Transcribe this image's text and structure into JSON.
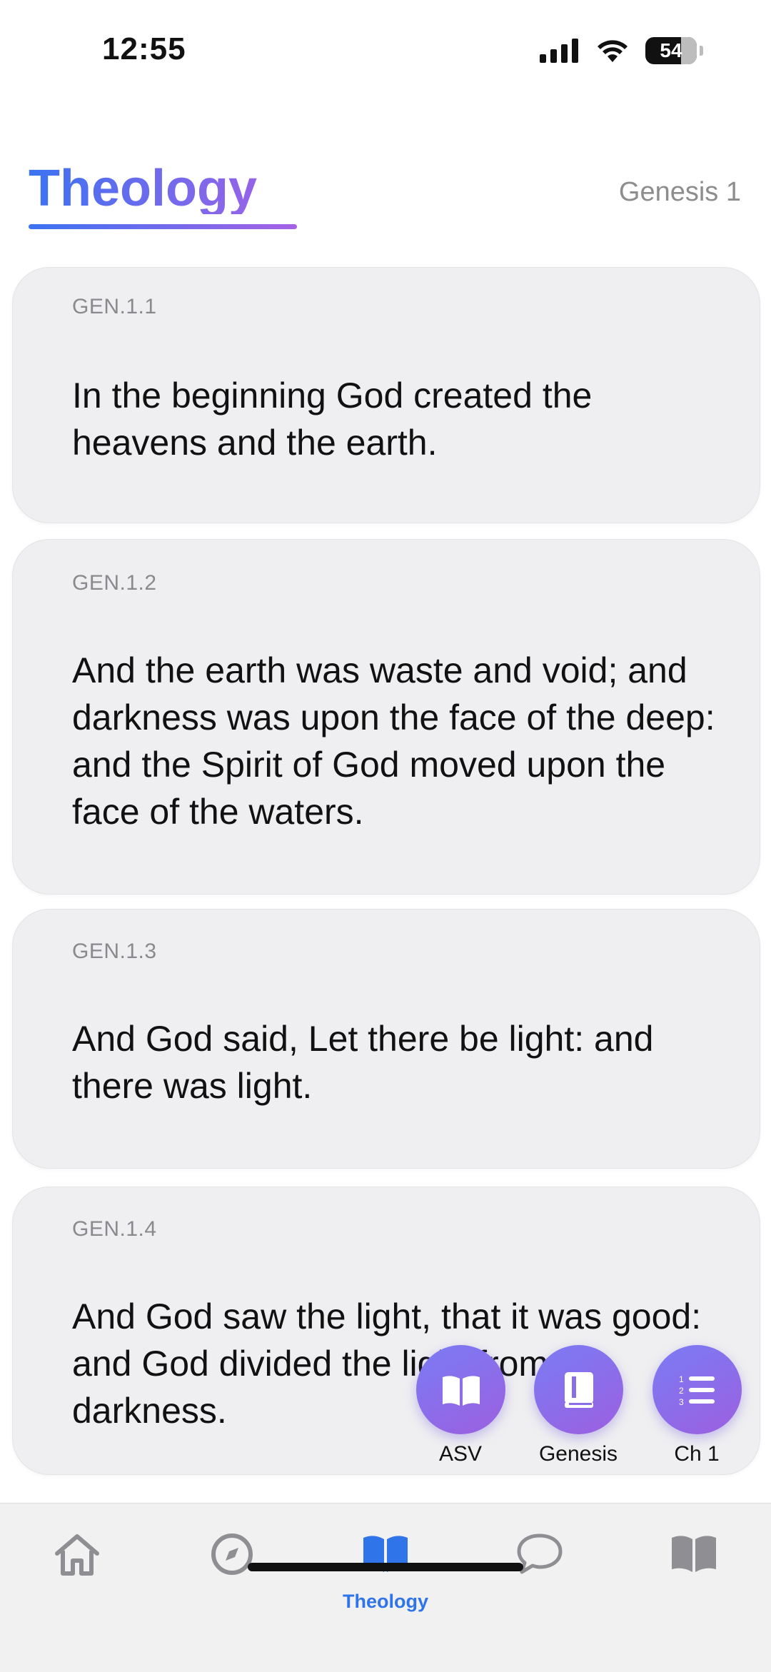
{
  "status_bar": {
    "time": "12:55",
    "battery": "54"
  },
  "header": {
    "app_title": "Theology",
    "book_chapter": "Genesis 1"
  },
  "verses": [
    {
      "ref": "GEN.1.1",
      "text": "In the beginning God created the heavens and the earth."
    },
    {
      "ref": "GEN.1.2",
      "text": "And the earth was waste and void; and darkness was upon the face of the deep: and the Spirit of God moved upon the face of the waters."
    },
    {
      "ref": "GEN.1.3",
      "text": "And God said, Let there be light: and there was light."
    },
    {
      "ref": "GEN.1.4",
      "text": "And God saw the light, that it was good: and God divided the light from the darkness."
    }
  ],
  "fabs": [
    {
      "label": "ASV",
      "icon": "open-book-icon"
    },
    {
      "label": "Genesis",
      "icon": "closed-book-icon"
    },
    {
      "label": "Ch 1",
      "icon": "numbered-list-icon"
    }
  ],
  "tab_bar": {
    "items": [
      {
        "icon": "home-icon"
      },
      {
        "icon": "compass-icon"
      },
      {
        "icon": "open-book-icon",
        "label": "Theology",
        "active": true
      },
      {
        "icon": "chat-bubble-icon"
      },
      {
        "icon": "book-icon"
      }
    ]
  },
  "colors": {
    "accent": "#2f74e8",
    "gradient_start": "#3b73f2",
    "gradient_end": "#a661e6",
    "card": "#efeff1"
  }
}
